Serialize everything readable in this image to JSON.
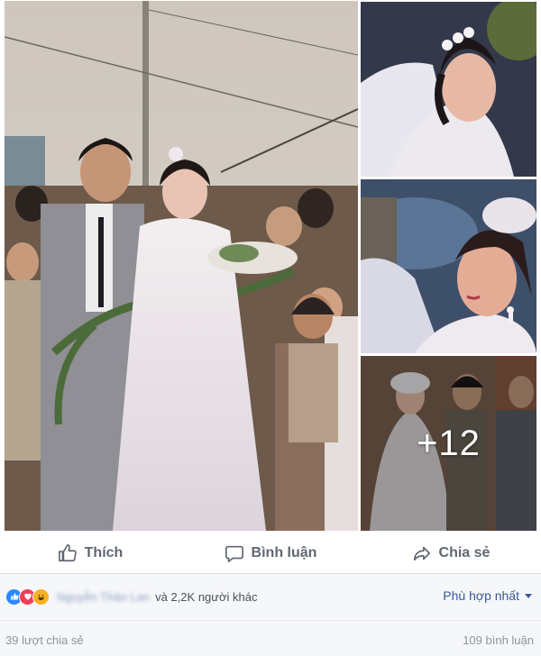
{
  "photos": {
    "main": {
      "label": "wedding-couple-street"
    },
    "top": {
      "label": "bride-portrait-veil"
    },
    "mid": {
      "label": "bride-profile-earring"
    },
    "bottom": {
      "label": "wedding-guests",
      "more_count": "+12"
    }
  },
  "actions": {
    "like_label": "Thích",
    "comment_label": "Bình luận",
    "share_label": "Chia sẻ"
  },
  "reactions": {
    "icons": [
      "like-icon",
      "love-icon",
      "haha-icon"
    ],
    "name_blurred": "Nguyễn Thảo Lan",
    "others_text": "và 2,2K người khác",
    "sort_label": "Phù hợp nhất"
  },
  "footer": {
    "shares_text": "39 lượt chia sẻ",
    "comments_text": "109 bình luận"
  },
  "colors": {
    "accent": "#385898",
    "like": "#2d88ff",
    "love": "#f33e58",
    "haha": "#f7b125"
  }
}
